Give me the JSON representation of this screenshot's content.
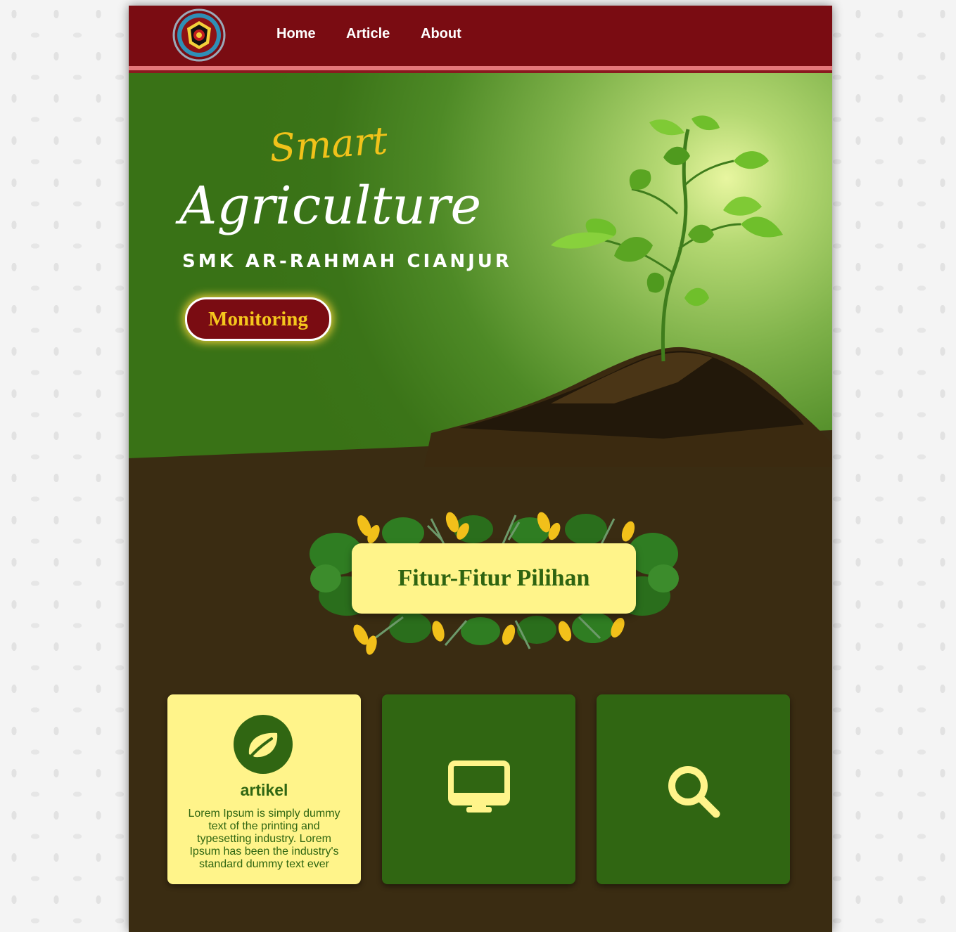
{
  "nav": {
    "logo": "school-logo",
    "links": [
      "Home",
      "Article",
      "About"
    ]
  },
  "hero": {
    "script_title": "Smart",
    "title": "Agriculture",
    "subtitle": "SMK AR-RAHMAH CIANJUR",
    "button": "Monitoring"
  },
  "features": {
    "heading": "Fitur-Fitur Pilihan",
    "cards": [
      {
        "icon": "leaf-icon",
        "title": "artikel",
        "text": "Lorem Ipsum is simply dummy text of the printing and typesetting industry. Lorem Ipsum has been the industry's standard dummy text ever"
      },
      {
        "icon": "monitor-icon"
      },
      {
        "icon": "search-icon"
      }
    ]
  },
  "colors": {
    "navbar": "#7a0c12",
    "hero_green": "#397216",
    "soil": "#3a2c12",
    "cream": "#fff48a",
    "card_green": "#306612",
    "gold": "#f5c71d"
  }
}
